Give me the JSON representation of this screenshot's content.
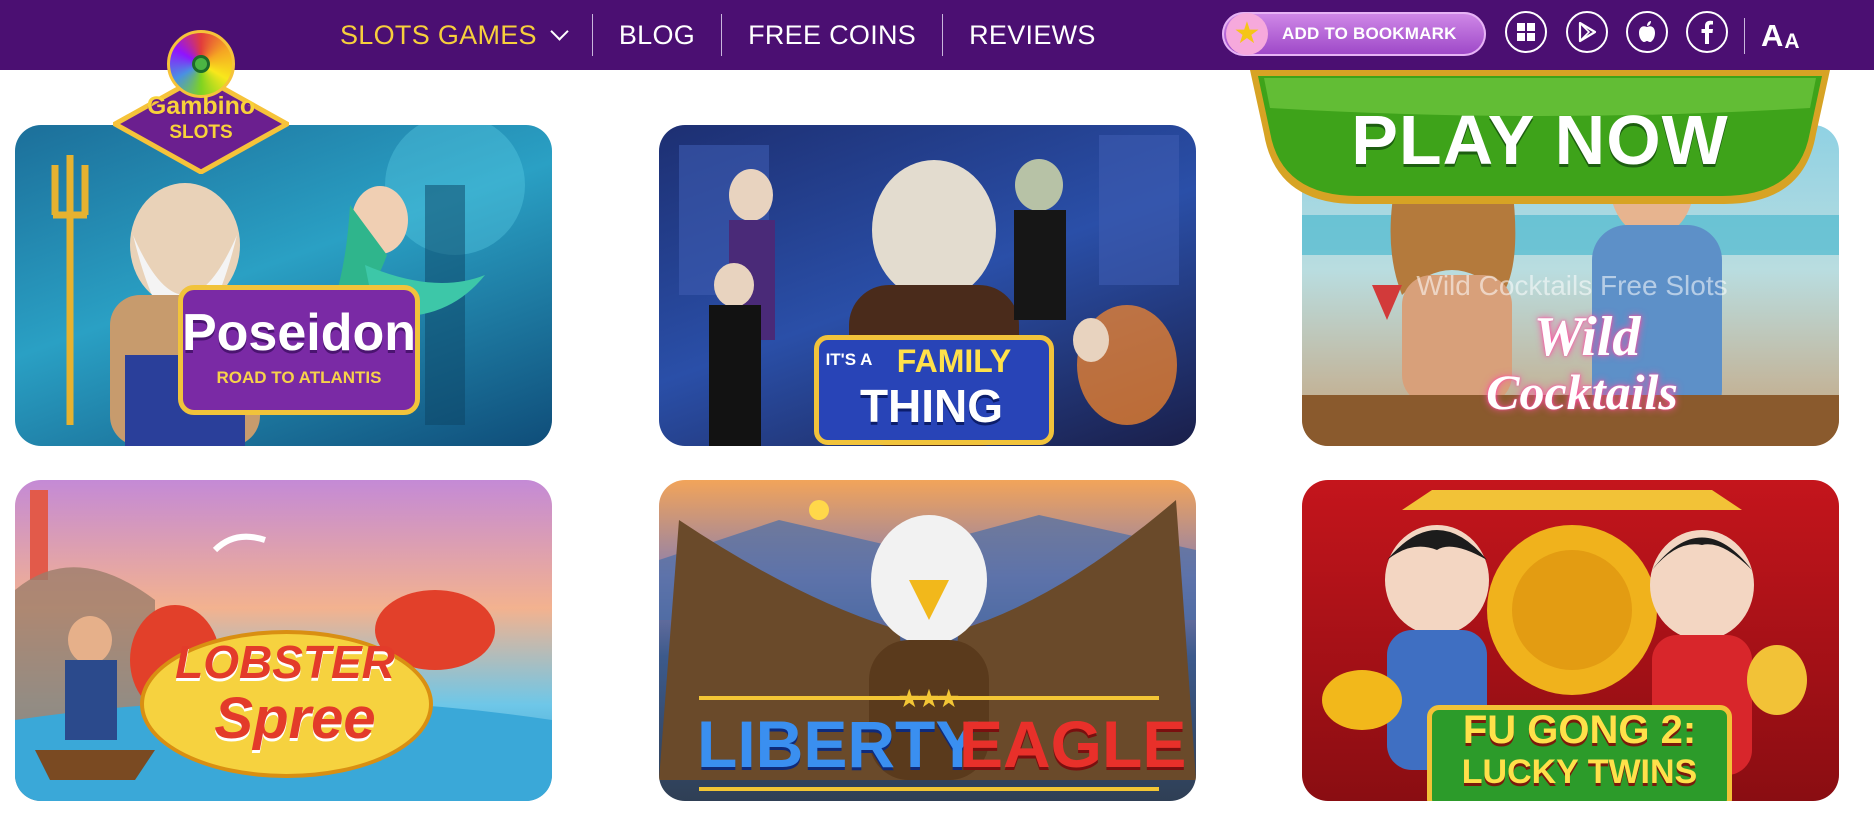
{
  "header": {
    "nav": [
      {
        "label": "SLOTS GAMES",
        "active": true,
        "has_dropdown": true
      },
      {
        "label": "BLOG"
      },
      {
        "label": "FREE COINS"
      },
      {
        "label": "REVIEWS"
      }
    ],
    "bookmark_label": "ADD TO BOOKMARK",
    "store_icons": [
      "windows-icon",
      "google-play-icon",
      "apple-icon",
      "facebook-icon"
    ],
    "font_size_label_big": "A",
    "font_size_label_small": "A",
    "colors": {
      "bar": "#4b0f72",
      "active_nav": "#f7cf3c"
    }
  },
  "logo": {
    "line1": "Gambino",
    "line2": "SLOTS"
  },
  "play_button": {
    "label": "PLAY NOW",
    "color": "#3ea31a"
  },
  "games": [
    {
      "title": "Poseidon",
      "subtitle": "ROAD TO ATLANTIS"
    },
    {
      "title_line1": "IT'S A",
      "title_line2": "FAMILY",
      "title_line3": "THING"
    },
    {
      "title_line1": "Wild",
      "title_line2": "Cocktails",
      "watermark": "Wild Cocktails Free Slots"
    },
    {
      "title_line1": "LOBSTER",
      "title_line2": "Spree"
    },
    {
      "title_line1": "LIBERTY",
      "title_line2": "EAGLE"
    },
    {
      "title_line1": "FU GONG 2:",
      "title_line2": "LUCKY TWINS"
    }
  ]
}
